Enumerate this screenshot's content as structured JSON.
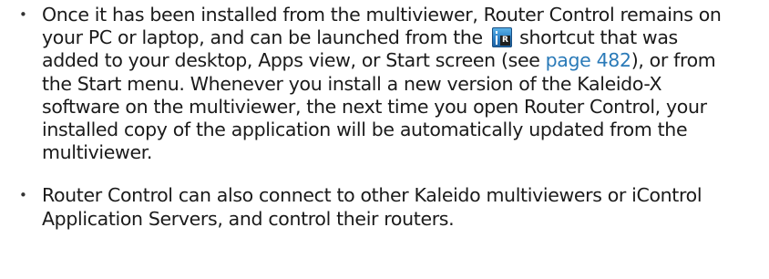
{
  "bullet": "•",
  "shortcut_icon": {
    "letter": "R",
    "colors": {
      "top": "#5fb6ea",
      "bottom": "#1d5f9e",
      "tile": "#1e1e1e"
    }
  },
  "link_color": "#2a7ab8",
  "items": [
    {
      "lines": [
        "Once it has been installed from the multiviewer, Router Control remains on",
        {
          "before": "your PC or laptop, and can be launched from the",
          "after": "shortcut that was"
        },
        {
          "before": "added to your desktop, Apps view, or Start screen (see ",
          "link": "page 482",
          "after": "), or from"
        },
        "the Start menu. Whenever you install a new version of the Kaleido-X",
        "software on the multiviewer, the next time you open Router Control, your",
        "installed copy of the application will be automatically updated from the",
        "multiviewer."
      ]
    },
    {
      "lines": [
        "Router Control can also connect to other Kaleido multiviewers or iControl",
        "Application Servers, and control their routers."
      ]
    }
  ]
}
